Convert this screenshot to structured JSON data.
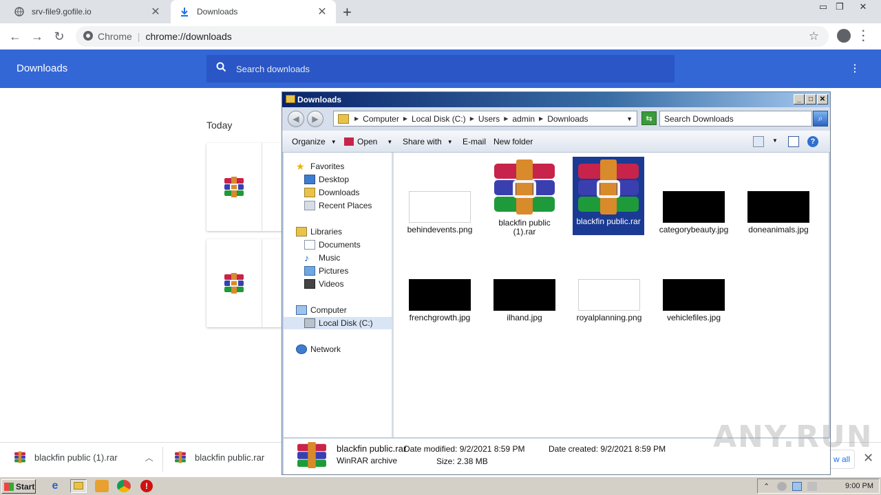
{
  "browser": {
    "tabs": [
      {
        "title": "srv-file9.gofile.io",
        "icon": "globe-icon"
      },
      {
        "title": "Downloads",
        "icon": "download-icon"
      }
    ],
    "omnibox": {
      "label": "Chrome",
      "url": "chrome://downloads"
    }
  },
  "downloads_page": {
    "title": "Downloads",
    "search_placeholder": "Search downloads",
    "section": "Today"
  },
  "shelf": {
    "items": [
      "blackfin public (1).rar",
      "blackfin public.rar"
    ],
    "show_all": "w all"
  },
  "explorer": {
    "title": "Downloads",
    "breadcrumb": [
      "Computer",
      "Local Disk (C:)",
      "Users",
      "admin",
      "Downloads"
    ],
    "search_placeholder": "Search Downloads",
    "commands": {
      "organize": "Organize",
      "open": "Open",
      "share_with": "Share with",
      "email": "E-mail",
      "new_folder": "New folder"
    },
    "nav": {
      "favorites": "Favorites",
      "desktop": "Desktop",
      "downloads": "Downloads",
      "recent_places": "Recent Places",
      "libraries": "Libraries",
      "documents": "Documents",
      "music": "Music",
      "pictures": "Pictures",
      "videos": "Videos",
      "computer": "Computer",
      "local_disk": "Local Disk (C:)",
      "network": "Network"
    },
    "files": [
      {
        "name": "behindevents.png",
        "kind": "white-thumb"
      },
      {
        "name": "blackfin public (1).rar",
        "kind": "winrar"
      },
      {
        "name": "blackfin public.rar",
        "kind": "winrar",
        "selected": true
      },
      {
        "name": "categorybeauty.jpg",
        "kind": "black-thumb"
      },
      {
        "name": "doneanimals.jpg",
        "kind": "black-thumb"
      },
      {
        "name": "frenchgrowth.jpg",
        "kind": "black-thumb"
      },
      {
        "name": "ilhand.jpg",
        "kind": "black-thumb"
      },
      {
        "name": "royalplanning.png",
        "kind": "white-thumb"
      },
      {
        "name": "vehiclefiles.jpg",
        "kind": "black-thumb"
      }
    ],
    "details": {
      "name": "blackfin public.rar",
      "type": "WinRAR archive",
      "date_modified_label": "Date modified:",
      "date_modified": "9/2/2021 8:59 PM",
      "date_created_label": "Date created:",
      "date_created": "9/2/2021 8:59 PM",
      "size_label": "Size:",
      "size": "2.38 MB"
    }
  },
  "watermark": "ANY.RUN",
  "taskbar": {
    "start": "Start",
    "clock": "9:00 PM"
  },
  "colors": {
    "chrome_header": "#3367d6",
    "selection": "#1a3a94"
  }
}
